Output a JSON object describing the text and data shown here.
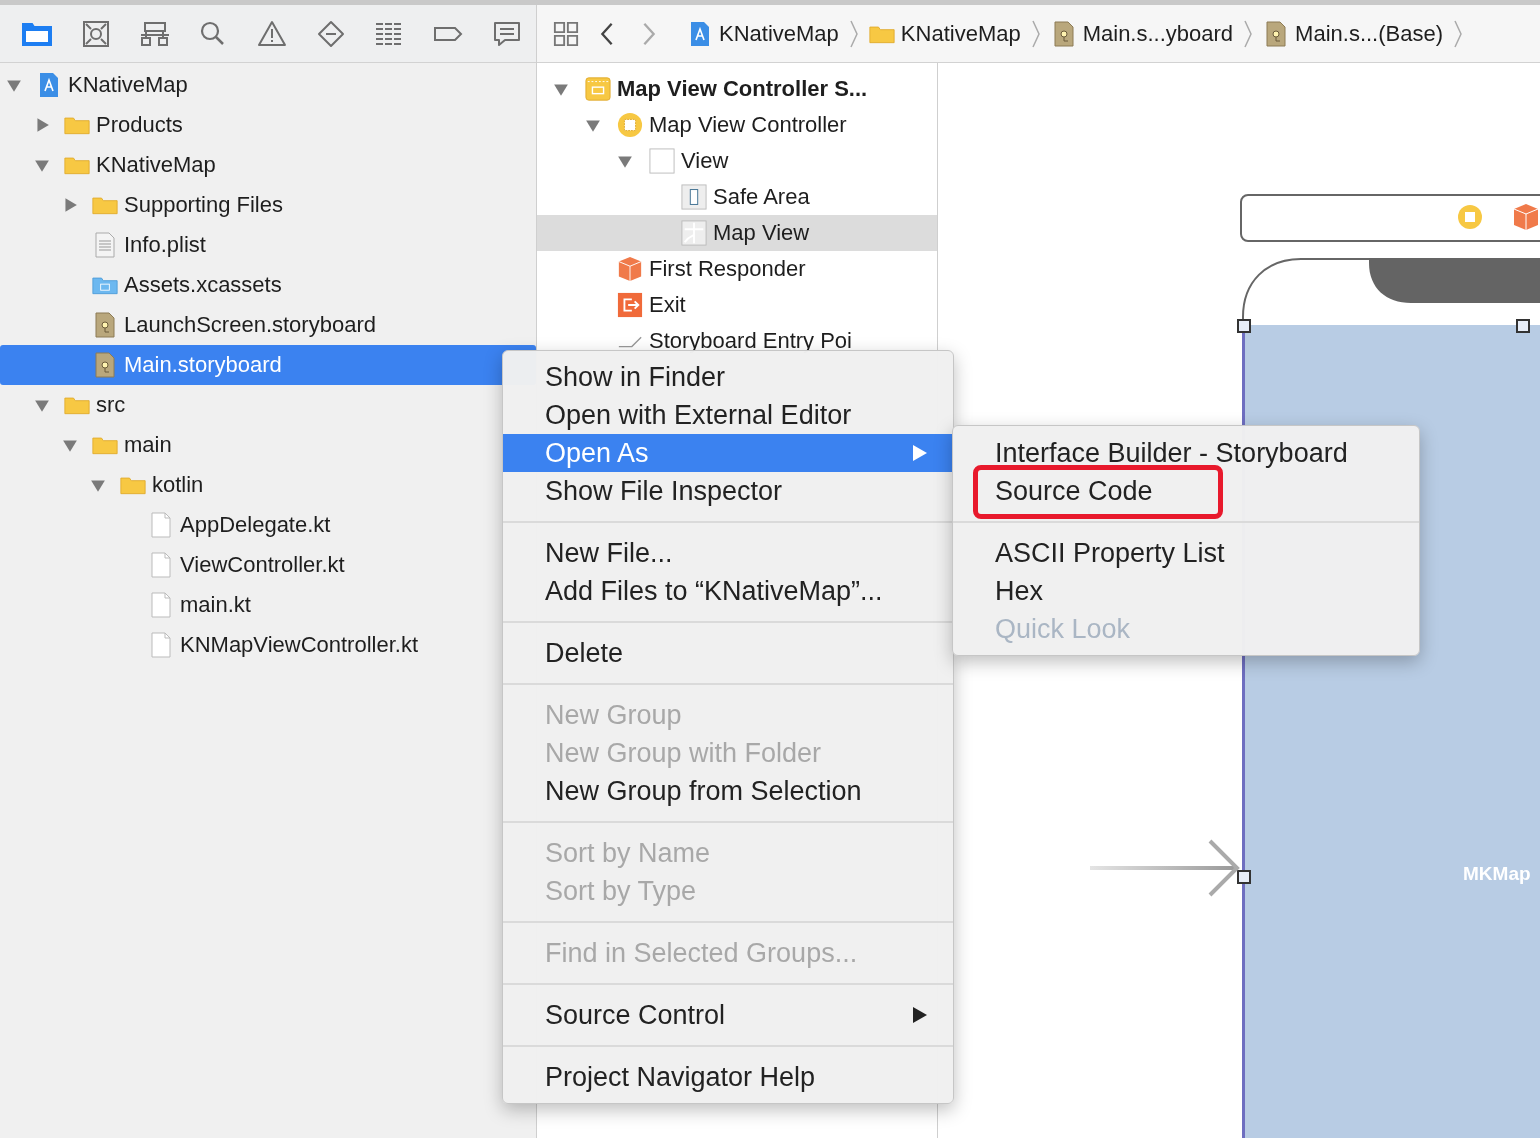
{
  "navigator_tabs": [
    {
      "kind": "folder",
      "selected": true
    },
    {
      "kind": "source-control",
      "selected": false
    },
    {
      "kind": "hierarchy",
      "selected": false
    },
    {
      "kind": "search",
      "selected": false
    },
    {
      "kind": "warning",
      "selected": false
    },
    {
      "kind": "test",
      "selected": false
    },
    {
      "kind": "debug",
      "selected": false
    },
    {
      "kind": "breakpoint",
      "selected": false
    },
    {
      "kind": "report",
      "selected": false
    }
  ],
  "jump_bar": {
    "items": [
      {
        "label": "KNativeMap",
        "kind": "project"
      },
      {
        "label": "KNativeMap",
        "kind": "folder"
      },
      {
        "label": "Main.s...yboard",
        "kind": "storyboard"
      },
      {
        "label": "Main.s...(Base)",
        "kind": "storyboard"
      }
    ]
  },
  "file_tree": [
    {
      "label": "KNativeMap",
      "kind": "project",
      "expanded": true,
      "selected": false,
      "children": [
        {
          "label": "Products",
          "kind": "folder",
          "expanded": false,
          "selected": false
        },
        {
          "label": "KNativeMap",
          "kind": "folder",
          "expanded": true,
          "selected": false,
          "children": [
            {
              "label": "Supporting Files",
              "kind": "folder",
              "expanded": false,
              "selected": false
            },
            {
              "label": "Info.plist",
              "kind": "plist",
              "selected": false
            },
            {
              "label": "Assets.xcassets",
              "kind": "assets",
              "selected": false
            },
            {
              "label": "LaunchScreen.storyboard",
              "kind": "storyboard",
              "selected": false
            },
            {
              "label": "Main.storyboard",
              "kind": "storyboard",
              "selected": true
            }
          ]
        },
        {
          "label": "src",
          "kind": "folder",
          "expanded": true,
          "selected": false,
          "children": [
            {
              "label": "main",
              "kind": "folder",
              "expanded": true,
              "selected": false,
              "children": [
                {
                  "label": "kotlin",
                  "kind": "folder",
                  "expanded": true,
                  "selected": false,
                  "children": [
                    {
                      "label": "AppDelegate.kt",
                      "kind": "file",
                      "selected": false
                    },
                    {
                      "label": "ViewController.kt",
                      "kind": "file",
                      "selected": false
                    },
                    {
                      "label": "main.kt",
                      "kind": "file",
                      "selected": false
                    },
                    {
                      "label": "KNMapViewController.kt",
                      "kind": "file",
                      "selected": false
                    }
                  ]
                }
              ]
            }
          ]
        }
      ]
    }
  ],
  "document_outline": [
    {
      "label": "Map View Controller S...",
      "kind": "scene",
      "expanded": true,
      "selected": false,
      "children": [
        {
          "label": "Map View Controller",
          "kind": "controller",
          "expanded": true,
          "selected": false,
          "children": [
            {
              "label": "View",
              "kind": "view",
              "expanded": true,
              "selected": false,
              "children": [
                {
                  "label": "Safe Area",
                  "kind": "safe-area",
                  "selected": false
                },
                {
                  "label": "Map View",
                  "kind": "map",
                  "selected": true
                }
              ]
            }
          ]
        },
        {
          "label": "First Responder",
          "kind": "responder",
          "selected": false
        },
        {
          "label": "Exit",
          "kind": "exit",
          "selected": false
        },
        {
          "label": "Storyboard Entry Poi",
          "kind": "entry",
          "selected": false
        }
      ]
    }
  ],
  "canvas": {
    "map_view_label": "MKMap"
  },
  "context_menu": {
    "groups": [
      [
        {
          "label": "Show in Finder",
          "disabled": false,
          "selected": false,
          "submenu": false
        },
        {
          "label": "Open with External Editor",
          "disabled": false,
          "selected": false,
          "submenu": false
        },
        {
          "label": "Open As",
          "disabled": false,
          "selected": true,
          "submenu": true
        },
        {
          "label": "Show File Inspector",
          "disabled": false,
          "selected": false,
          "submenu": false
        }
      ],
      [
        {
          "label": "New File...",
          "disabled": false,
          "selected": false,
          "submenu": false
        },
        {
          "label": "Add Files to “KNativeMap”...",
          "disabled": false,
          "selected": false,
          "submenu": false
        }
      ],
      [
        {
          "label": "Delete",
          "disabled": false,
          "selected": false,
          "submenu": false
        }
      ],
      [
        {
          "label": "New Group",
          "disabled": true,
          "selected": false,
          "submenu": false
        },
        {
          "label": "New Group with Folder",
          "disabled": true,
          "selected": false,
          "submenu": false
        },
        {
          "label": "New Group from Selection",
          "disabled": false,
          "selected": false,
          "submenu": false
        }
      ],
      [
        {
          "label": "Sort by Name",
          "disabled": true,
          "selected": false,
          "submenu": false
        },
        {
          "label": "Sort by Type",
          "disabled": true,
          "selected": false,
          "submenu": false
        }
      ],
      [
        {
          "label": "Find in Selected Groups...",
          "disabled": true,
          "selected": false,
          "submenu": false
        }
      ],
      [
        {
          "label": "Source Control",
          "disabled": false,
          "selected": false,
          "submenu": true
        }
      ],
      [
        {
          "label": "Project Navigator Help",
          "disabled": false,
          "selected": false,
          "submenu": false
        }
      ]
    ]
  },
  "open_as_submenu": {
    "groups": [
      [
        {
          "label": "Interface Builder - Storyboard",
          "disabled": false,
          "highlighted": false
        },
        {
          "label": "Source Code",
          "disabled": false,
          "highlighted": true
        }
      ],
      [
        {
          "label": "ASCII Property List",
          "disabled": false,
          "highlighted": false
        },
        {
          "label": "Hex",
          "disabled": false,
          "highlighted": false
        },
        {
          "label": "Quick Look",
          "disabled": true,
          "highlighted": false
        }
      ]
    ]
  }
}
